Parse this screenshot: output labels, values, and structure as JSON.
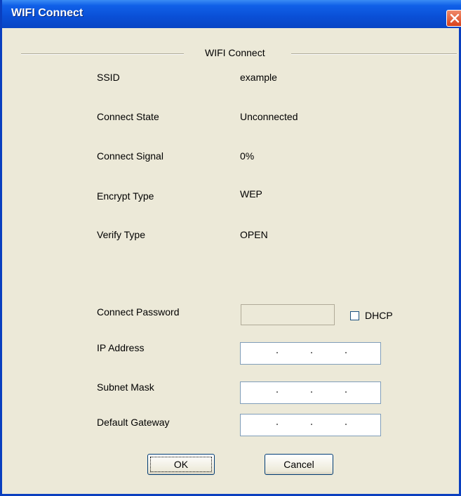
{
  "window": {
    "title": "WIFI Connect"
  },
  "group": {
    "title": "WIFI Connect"
  },
  "info": [
    {
      "label": "SSID",
      "value": "example"
    },
    {
      "label": "Connect State",
      "value": "Unconnected"
    },
    {
      "label": "Connect Signal",
      "value": "0%"
    },
    {
      "label": "Encrypt Type",
      "value": "WEP"
    },
    {
      "label": "Verify Type",
      "value": "OPEN"
    }
  ],
  "form": {
    "password_label": "Connect Password",
    "password_value": "",
    "dhcp_label": "DHCP",
    "dhcp_checked": false,
    "ip_label": "IP Address",
    "subnet_label": "Subnet Mask",
    "gateway_label": "Default Gateway"
  },
  "buttons": {
    "ok_label": "OK",
    "cancel_label": "Cancel"
  },
  "colors": {
    "titlebar": "#0a4fd6",
    "close": "#d8421c",
    "dialog_bg": "#ece9d8"
  }
}
